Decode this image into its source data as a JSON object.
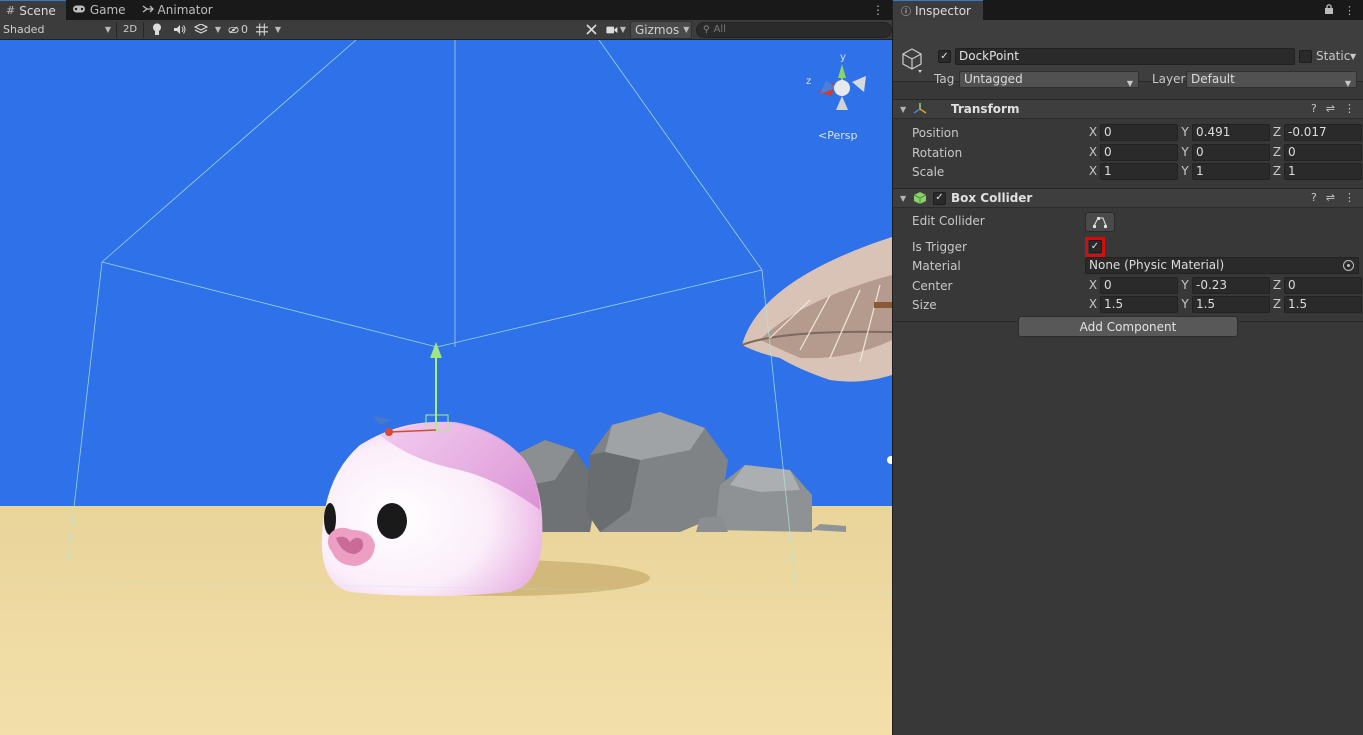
{
  "scene_tabs": [
    {
      "label": "Scene",
      "icon": "grid-icon"
    },
    {
      "label": "Game",
      "icon": "gamepad-icon"
    },
    {
      "label": "Animator",
      "icon": "animator-icon"
    }
  ],
  "scene_toolbar": {
    "shading_mode": "Shaded",
    "mode_2d": "2D",
    "hidden_count": "0",
    "gizmos_label": "Gizmos",
    "search_placeholder": "All"
  },
  "viewport": {
    "projection_label": "Persp",
    "gizmo_axes": {
      "y": "y",
      "z": "z"
    }
  },
  "inspector": {
    "tab_label": "Inspector",
    "game_object": {
      "name": "DockPoint",
      "active": true,
      "static_label": "Static",
      "static_checked": false,
      "tag_label": "Tag",
      "tag_value": "Untagged",
      "layer_label": "Layer",
      "layer_value": "Default"
    },
    "transform": {
      "title": "Transform",
      "rows": [
        {
          "label": "Position",
          "x": "0",
          "y": "0.491",
          "z": "-0.017"
        },
        {
          "label": "Rotation",
          "x": "0",
          "y": "0",
          "z": "0"
        },
        {
          "label": "Scale",
          "x": "1",
          "y": "1",
          "z": "1"
        }
      ]
    },
    "box_collider": {
      "title": "Box Collider",
      "enabled": true,
      "edit_collider_label": "Edit Collider",
      "is_trigger_label": "Is Trigger",
      "is_trigger": true,
      "material_label": "Material",
      "material_value": "None (Physic Material)",
      "center": {
        "label": "Center",
        "x": "0",
        "y": "-0.23",
        "z": "0"
      },
      "size": {
        "label": "Size",
        "x": "1.5",
        "y": "1.5",
        "z": "1.5"
      }
    },
    "add_component_label": "Add Component"
  },
  "axis_labels": {
    "x": "X",
    "y": "Y",
    "z": "Z"
  },
  "colors": {
    "sky": "#2f71e8",
    "sand": "#efd79b",
    "highlight": "#d60d0d",
    "tab_accent": "#3a79bb"
  }
}
